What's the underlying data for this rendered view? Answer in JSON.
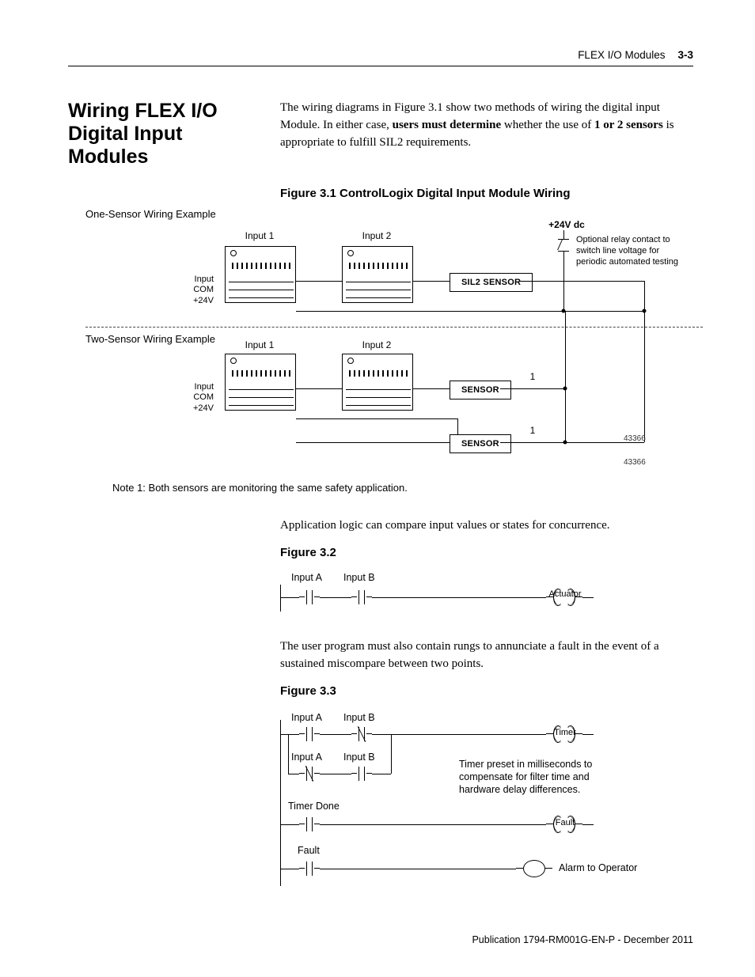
{
  "runhead": {
    "title": "FLEX I/O Modules",
    "page": "3-3"
  },
  "section": {
    "heading": "Wiring FLEX I/O Digital Input Modules",
    "para_before": "The wiring diagrams in Figure 3.1 show two methods of wiring the digital input Module. In either case, ",
    "para_strong": "users must determine",
    "para_mid": " whether the use of ",
    "para_strong2": "1 or 2 sensors",
    "para_after": " is appropriate to fulfill SIL2 requirements."
  },
  "fig31": {
    "caption": "Figure 3.1 ControlLogix Digital Input Module Wiring",
    "one_sensor_title": "One-Sensor Wiring Example",
    "two_sensor_title": "Two-Sensor Wiring Example",
    "input1": "Input 1",
    "input2": "Input 2",
    "row_input": "Input",
    "row_com": "COM",
    "row_24v": "+24V",
    "v24": "+24V dc",
    "relay_text": "Optional relay contact to switch line voltage for periodic automated testing",
    "sil2_sensor": "SIL2 SENSOR",
    "sensor": "SENSOR",
    "one": "1",
    "id1": "43366",
    "id2": "43366",
    "note": "Note 1: Both sensors are monitoring the same safety application."
  },
  "para2": "Application logic can compare input values or states for concurrence.",
  "fig32": {
    "caption": "Figure 3.2",
    "inputA": "Input A",
    "inputB": "Input B",
    "actuator": "Actuator"
  },
  "para3": "The user program must also contain rungs to annunciate a fault in the event of a sustained miscompare between two points.",
  "fig33": {
    "caption": "Figure 3.3",
    "inputA": "Input A",
    "inputB": "Input B",
    "timer": "Timer",
    "timer_done": "Timer Done",
    "fault": "Fault",
    "alarm": "Alarm to Operator",
    "timer_note": "Timer preset in milliseconds to compensate for filter time and hardware delay differences."
  },
  "footer": "Publication 1794-RM001G-EN-P - December 2011"
}
